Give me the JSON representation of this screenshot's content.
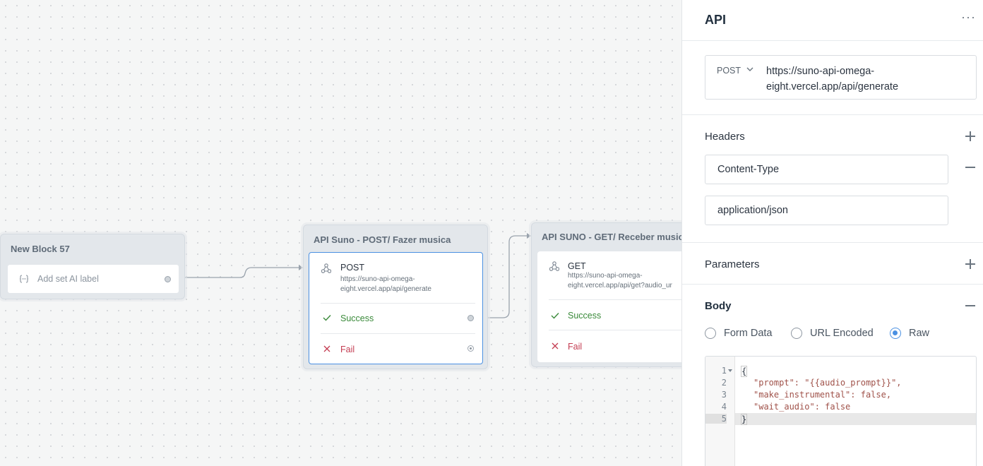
{
  "canvas": {
    "block1": {
      "title": "New Block 57",
      "item_label": "Add set AI label"
    },
    "block2": {
      "title": "API Suno - POST/ Fazer musica",
      "method": "POST",
      "url": "https://suno-api-omega-eight.vercel.app/api/generate",
      "url_line1": "https://suno-api-omega-",
      "url_line2": "eight.vercel.app/api/generate",
      "success": "Success",
      "fail": "Fail"
    },
    "block3": {
      "title": "API SUNO - GET/ Receber musica",
      "method": "GET",
      "url_line1": "https://suno-api-omega-",
      "url_line2": "eight.vercel.app/api/get?audio_ur",
      "success": "Success",
      "fail": "Fail"
    }
  },
  "panel": {
    "title": "API",
    "more_label": "···",
    "method": "POST",
    "url_line1": "https://suno-api-omega-",
    "url_line2": "eight.vercel.app/api/generate",
    "headers": {
      "title": "Headers",
      "key": "Content-Type",
      "value": "application/json"
    },
    "parameters": {
      "title": "Parameters"
    },
    "body": {
      "title": "Body",
      "options": [
        "Form Data",
        "URL Encoded",
        "Raw"
      ],
      "selected": "Raw",
      "code_lines": [
        "{",
        "\"prompt\": \"{{audio_prompt}}\",",
        "\"make_instrumental\": false,",
        "\"wait_audio\": false",
        "}"
      ],
      "line_numbers": [
        "1",
        "2",
        "3",
        "4",
        "5"
      ]
    }
  },
  "colors": {
    "accent": "#4a90e2",
    "success": "#3a8a3a",
    "fail": "#c43d52"
  }
}
